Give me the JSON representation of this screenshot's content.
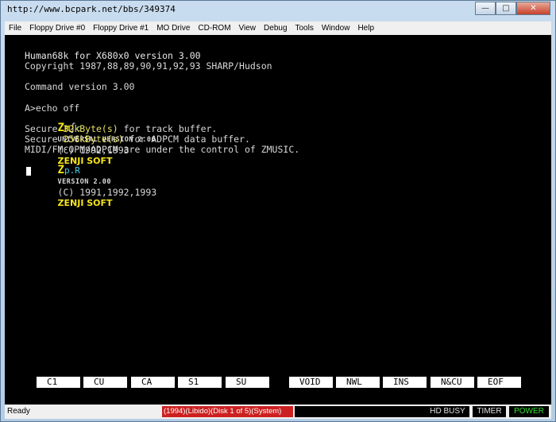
{
  "window": {
    "title": "http://www.bcpark.net/bbs/349374",
    "minimize_icon": "minimize-icon",
    "maximize_icon": "maximize-icon",
    "close_icon": "close-icon"
  },
  "menu": [
    "File",
    "Floppy Drive #0",
    "Floppy Drive #1",
    "MO Drive",
    "CD-ROM",
    "View",
    "Debug",
    "Tools",
    "Window",
    "Help"
  ],
  "screen": {
    "line1": "Human68k for X680x0 version 3.00",
    "line2": "Copyright 1987,88,89,90,91,92,93 SHARP/Hudson",
    "line3": "Command version 3.00",
    "line4": "A>echo off",
    "zmsc_logo": {
      "z": "Z",
      "m": "m",
      "s": "∫",
      "c": "c"
    },
    "zmsc_version": "UNIVERSAL VERSION 2.00",
    "zmsc_copy": "(C) 1992,1993",
    "zenji1": "ZENJI SOFT",
    "secure1_prefix": "Secure ",
    "secure1_value": "32kByte(s)",
    "secure1_suffix": " for track buffer.",
    "secure2_prefix": "Secure ",
    "secure2_value": "256kByte(s)",
    "secure2_suffix": " for ADPCM data buffer.",
    "midi_line": "MIDI/FM·OPM/ADPCM are under the control of ZMUSIC.",
    "zpr_logo": {
      "z": "Z",
      "rest": "p.R"
    },
    "zpr_version": "VERSION 2.00",
    "zpr_copy": "(C) 1991,1992,1993",
    "zenji2": "ZENJI SOFT"
  },
  "function_keys": [
    "C1",
    "CU",
    "CA",
    "S1",
    "SU",
    "VOID",
    "NWL",
    "INS",
    "N&CU",
    "EOF"
  ],
  "status": {
    "ready": "Ready",
    "disk": "(1994)(Libido)(Disk 1 of 5)(System)",
    "indicators": [
      "HD BUSY",
      "TIMER",
      "POWER"
    ]
  },
  "colors": {
    "screen_bg": "#000000",
    "text": "#d8d8d8",
    "highlight": "#e8e060",
    "disk_bar": "#cc2020",
    "power": "#30e030"
  }
}
